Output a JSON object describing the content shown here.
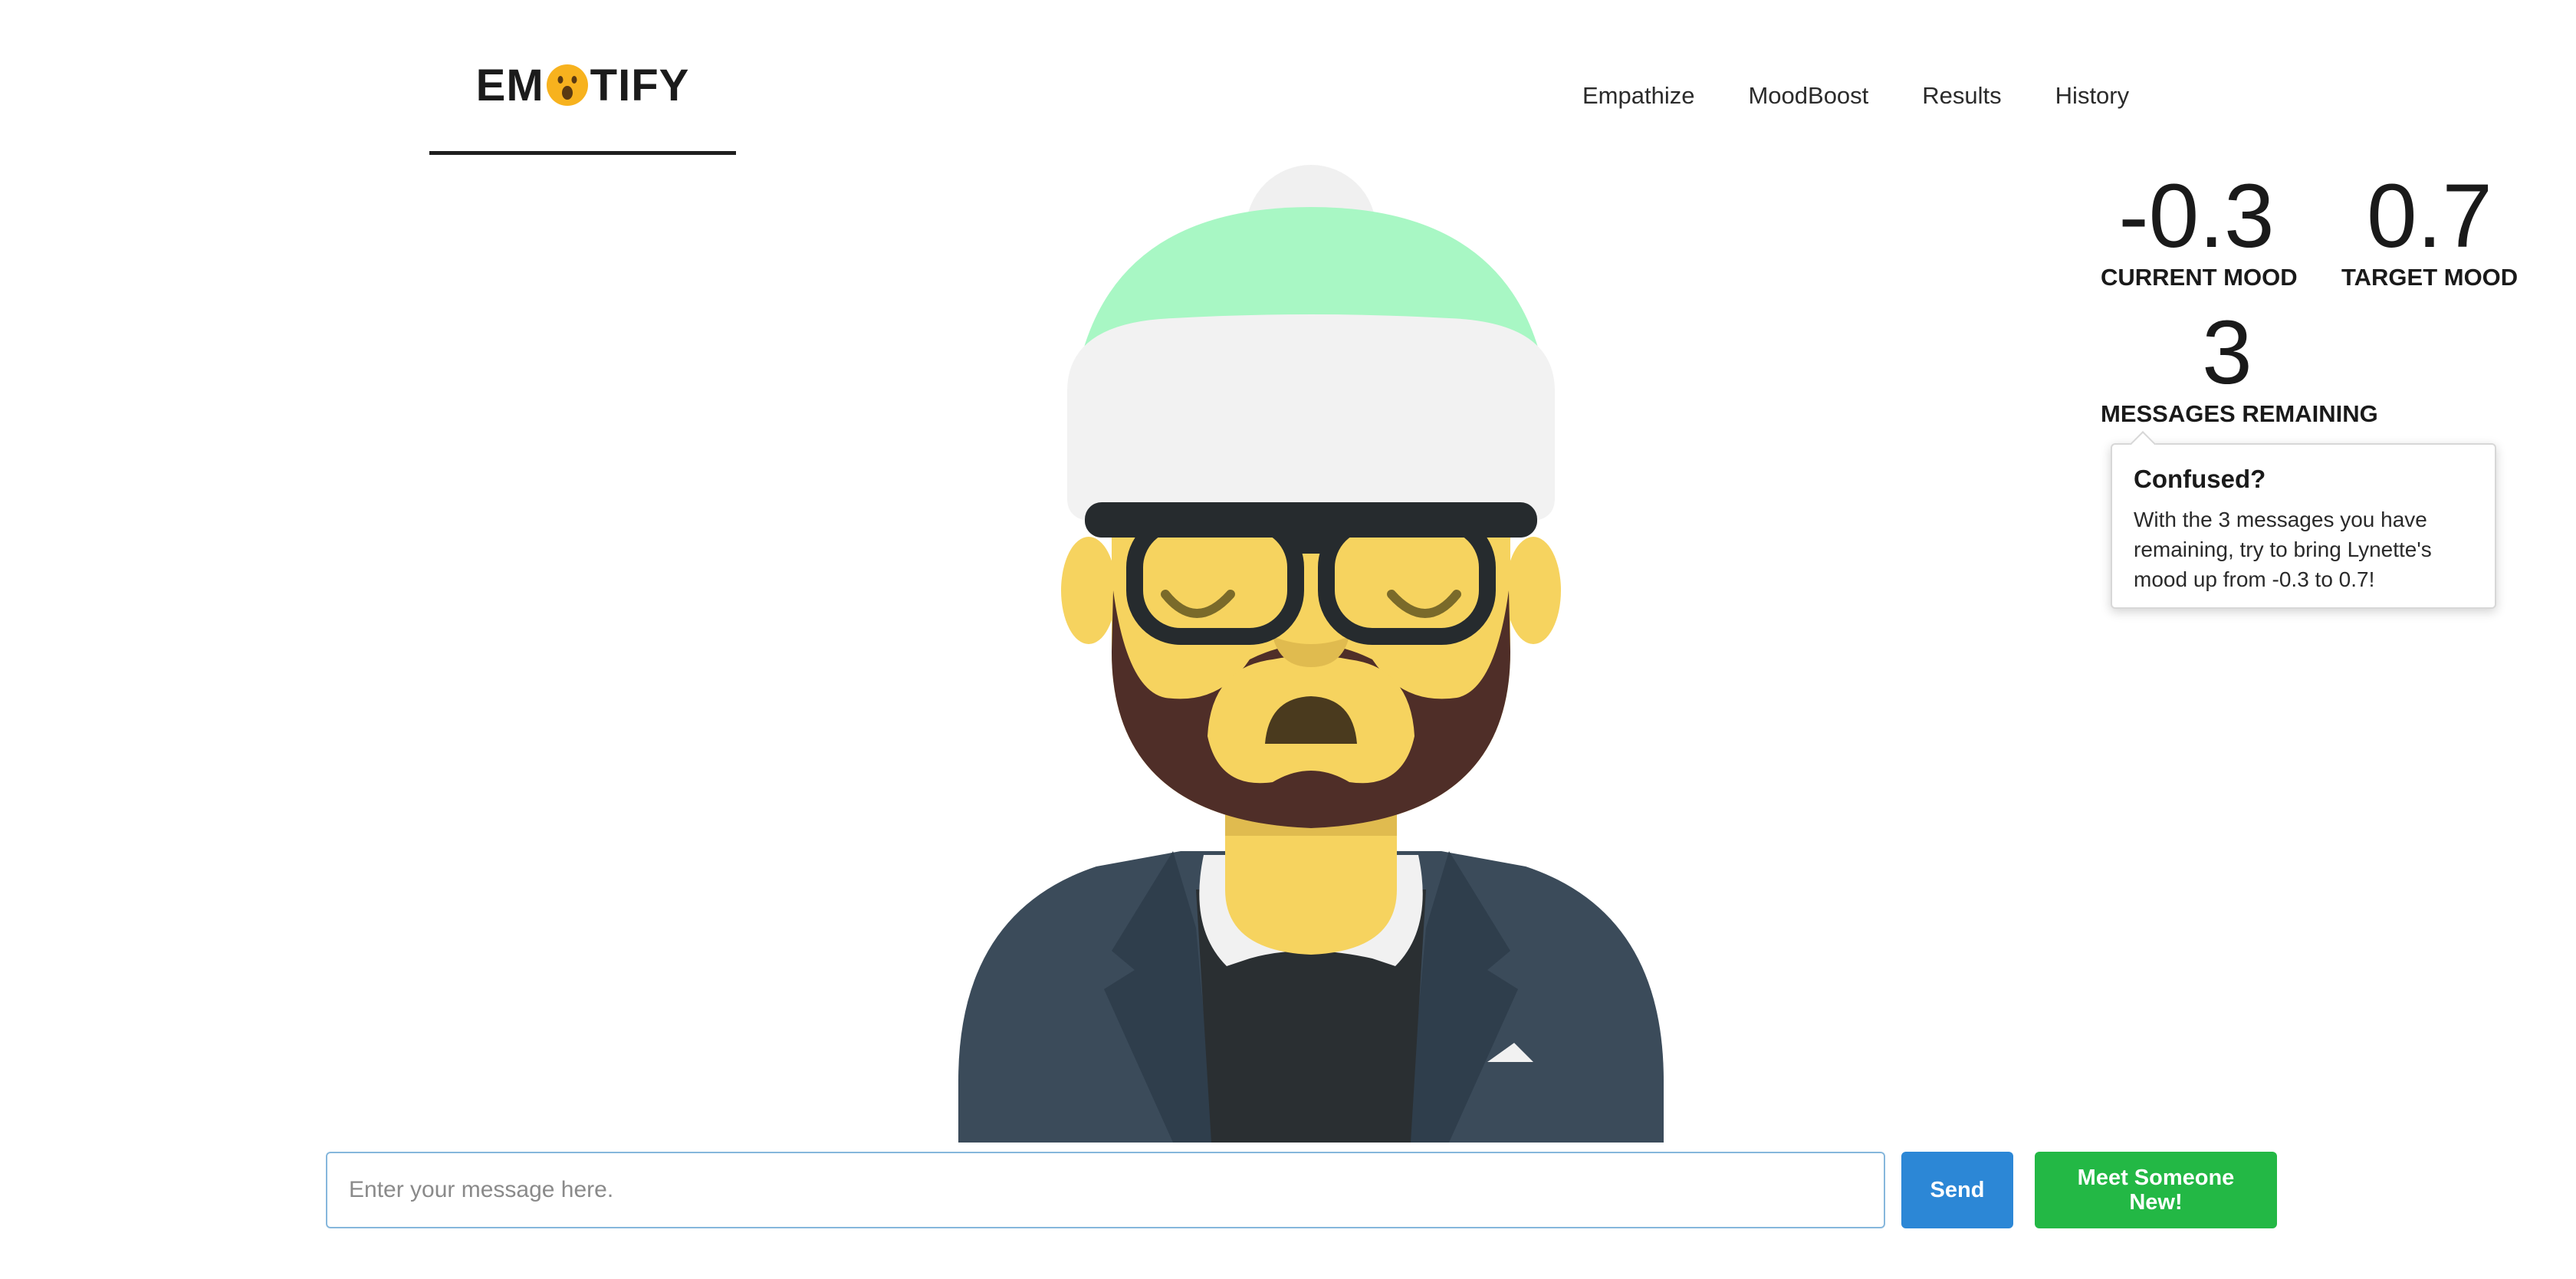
{
  "brand": {
    "logo_before": "EM",
    "logo_after": "TIFY",
    "logo_icon": "surprised-face-icon"
  },
  "nav": {
    "items": [
      "Empathize",
      "MoodBoost",
      "Results",
      "History"
    ]
  },
  "stats": {
    "current_mood": {
      "value": "-0.3",
      "label": "CURRENT MOOD"
    },
    "target_mood": {
      "value": "0.7",
      "label": "TARGET MOOD"
    },
    "messages_remaining": {
      "value": "3",
      "label": "MESSAGES REMAINING"
    }
  },
  "popover": {
    "title": "Confused?",
    "body": "With the 3 messages you have remaining, try to bring Lynette's mood up from -0.3 to 0.7!"
  },
  "composer": {
    "placeholder": "Enter your message here.",
    "send_label": "Send",
    "meet_label": "Meet Someone New!"
  },
  "colors": {
    "send_button": "#2c87d6",
    "meet_button": "#23b845",
    "beanie": "#a8f7c4",
    "skin": "#f6d35f",
    "beard": "#4f2e28",
    "jacket": "#3b4b5a"
  }
}
